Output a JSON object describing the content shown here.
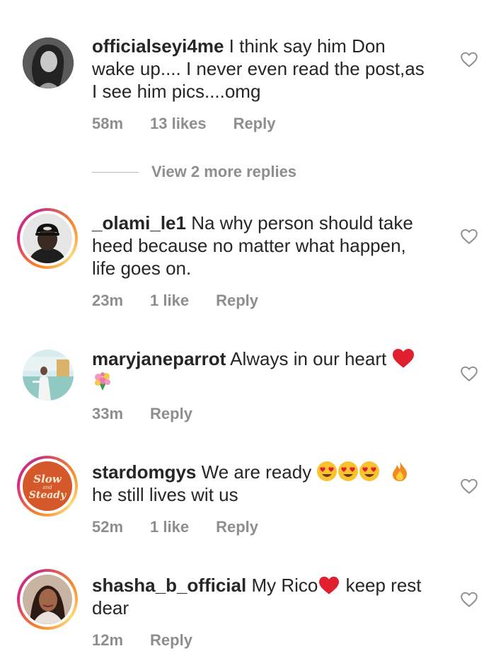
{
  "comments": [
    {
      "username": "officialseyi4me",
      "text_lines": [
        "I think say him Don",
        "wake up.... I never even read the post,as",
        "I see him pics....omg"
      ],
      "time": "58m",
      "likes": "13 likes",
      "reply": "Reply"
    },
    {
      "username": "_olami_le1",
      "text_lines": [
        "Na why person should take",
        "heed because no matter what happen,",
        "life goes on."
      ],
      "time": "23m",
      "likes": "1 like",
      "reply": "Reply"
    },
    {
      "username": "maryjaneparrot",
      "text": "Always in our heart",
      "time": "33m",
      "reply": "Reply"
    },
    {
      "username": "stardomgys",
      "text_a": "We are ready",
      "text_line2": "he still lives wit us",
      "time": "52m",
      "likes": "1 like",
      "reply": "Reply",
      "avatar_text": [
        "Slow",
        "and",
        "Steady"
      ]
    },
    {
      "username": "shasha_b_official",
      "text_a": "My Rico",
      "text_b": " keep rest",
      "text_line2": "dear",
      "time": "12m",
      "reply": "Reply"
    }
  ],
  "view_more": "View 2 more replies",
  "colors": {
    "text": "#262626",
    "meta": "#8e8e8e",
    "heart_emoji": "#e0245e",
    "ring_start": "#f58529",
    "ring_mid": "#dd2a7b"
  },
  "icons": {
    "like": "heart-outline-icon",
    "emoji_heart": "red-heart-emoji",
    "emoji_bouquet": "bouquet-emoji",
    "emoji_heart_eyes": "heart-eyes-emoji",
    "emoji_fire": "fire-emoji"
  }
}
